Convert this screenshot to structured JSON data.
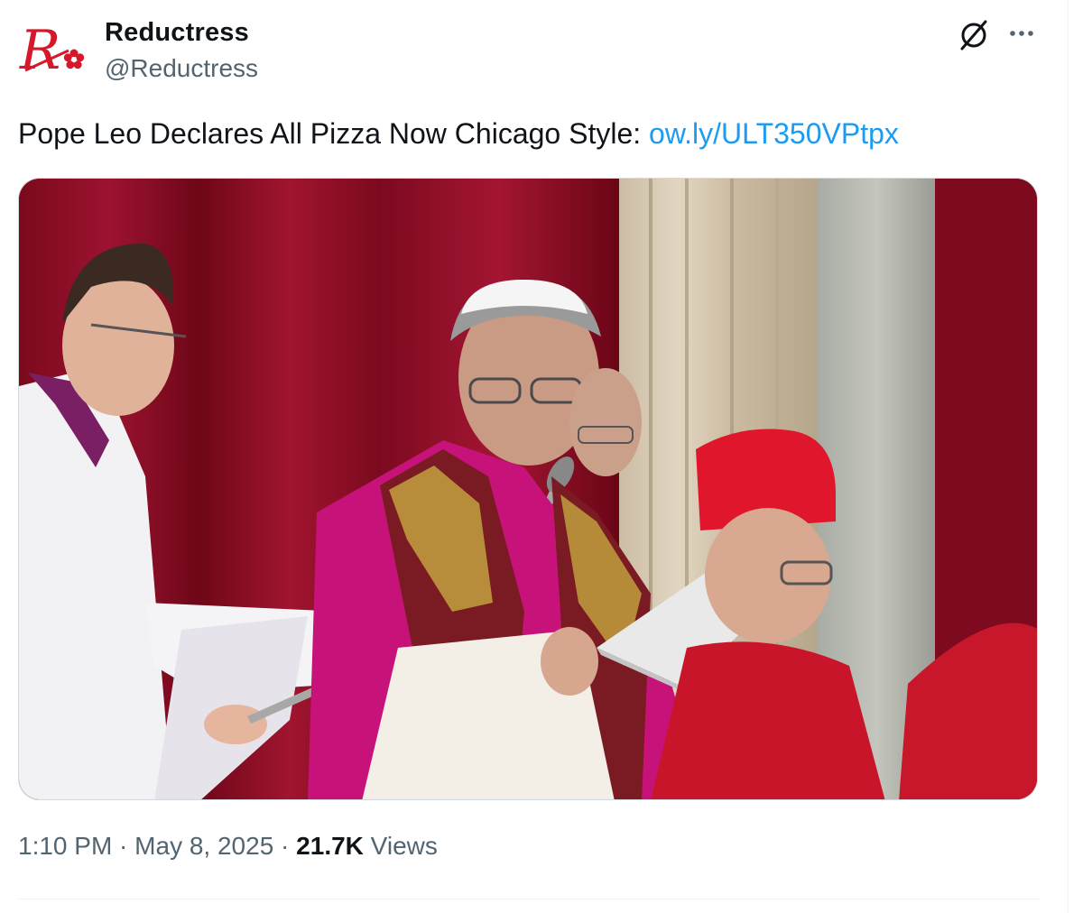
{
  "author": {
    "display_name": "Reductress",
    "handle": "@Reductress",
    "avatar_letter": "R"
  },
  "tweet": {
    "text": "Pope Leo Declares All Pizza Now Chicago Style: ",
    "link": "ow.ly/ULT350VPtpx"
  },
  "meta": {
    "time": "1:10 PM",
    "separator": " · ",
    "date": "May 8, 2025",
    "views_count": "21.7K",
    "views_label": "Views"
  },
  "icons": {
    "grok": "grok-icon",
    "more": "more-icon"
  },
  "colors": {
    "link": "#1d9bf0",
    "secondary_text": "#536471",
    "primary_text": "#0f1419",
    "brand_red": "#d4192b"
  }
}
